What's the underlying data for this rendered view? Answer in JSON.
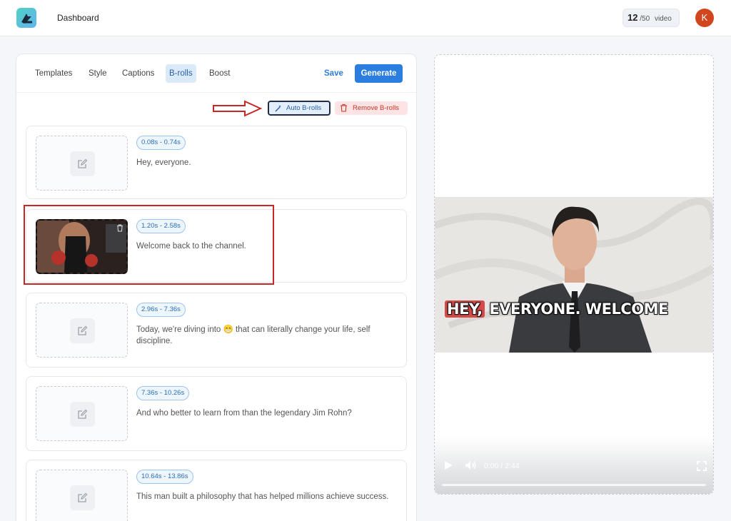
{
  "header": {
    "title": "Dashboard",
    "quota_used": "12",
    "quota_total": "/50",
    "quota_unit": "video",
    "avatar_initial": "K"
  },
  "editor": {
    "tabs": [
      {
        "label": "Templates"
      },
      {
        "label": "Style"
      },
      {
        "label": "Captions"
      },
      {
        "label": "B-rolls"
      },
      {
        "label": "Boost"
      }
    ],
    "active_tab": "B-rolls",
    "save_label": "Save",
    "generate_label": "Generate",
    "auto_broll_label": "Auto B-rolls",
    "remove_broll_label": "Remove B-rolls",
    "segments": [
      {
        "time": "0.08s - 0.74s",
        "text": "Hey, everyone.",
        "has_broll": false
      },
      {
        "time": "1.20s - 2.58s",
        "text": "Welcome back to the channel.",
        "has_broll": true
      },
      {
        "time": "2.96s - 7.36s",
        "text": "Today, we're diving into 😁 that can literally change your life, self discipline.",
        "has_broll": false
      },
      {
        "time": "7.36s - 10.26s",
        "text": "And who better to learn from than the legendary Jim Rohn?",
        "has_broll": false
      },
      {
        "time": "10.64s - 13.86s",
        "text": "This man built a philosophy that has helped millions achieve success.",
        "has_broll": false
      }
    ]
  },
  "preview": {
    "subtitle_highlight": "HEY,",
    "subtitle_rest": "EVERYONE. WELCOME",
    "time_display": "0:00 / 2:44",
    "progress": 0
  },
  "colors": {
    "accent": "#2b7de0",
    "danger": "#c0392b",
    "annotation": "#c62828"
  }
}
